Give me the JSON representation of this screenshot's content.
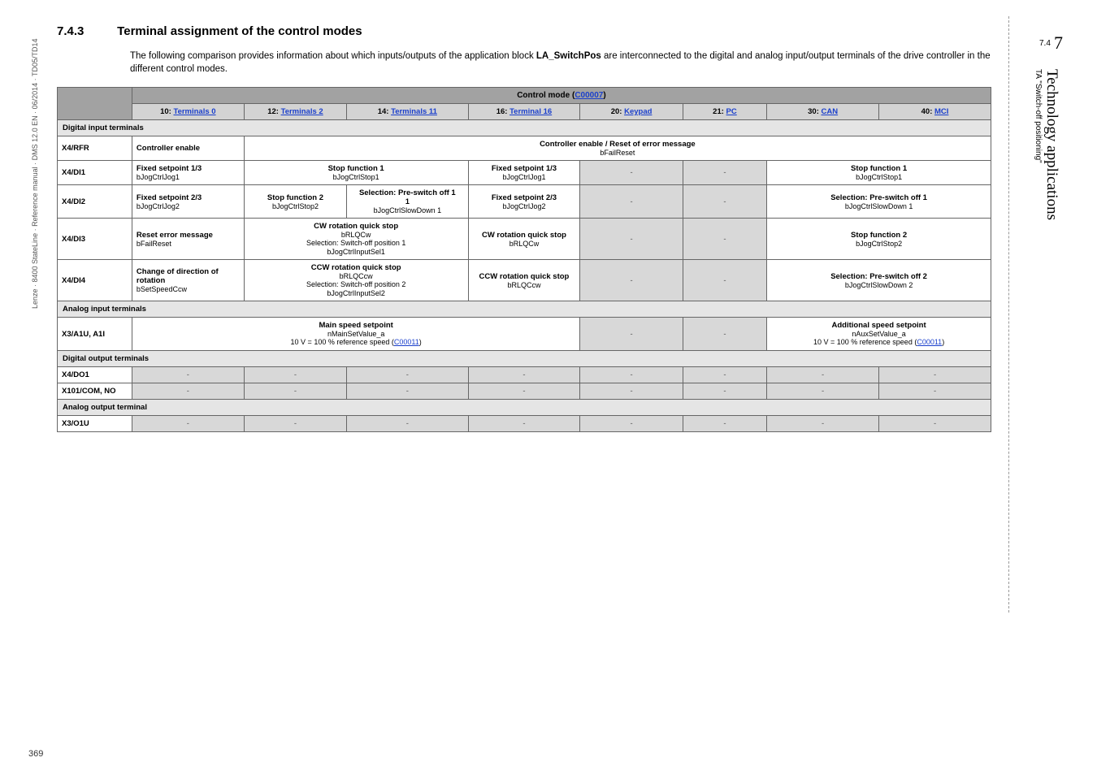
{
  "sidebar_left": "Lenze · 8400 StateLine · Reference manual · DMS 12.0 EN · 06/2014 · TD05/TD14",
  "page_number": "369",
  "sidebar_right": {
    "chap": "7",
    "sub": "7.4",
    "big": "Technology applications",
    "small": "TA \"Switch-off positioning\""
  },
  "heading": {
    "num": "7.4.3",
    "title": "Terminal assignment of the control modes"
  },
  "intro_a": "The following comparison provides information about which inputs/outputs of the application block ",
  "intro_bold": "LA_SwitchPos",
  "intro_b": " are interconnected to the digital and analog input/output terminals of the drive controller in the different control modes.",
  "table": {
    "control_mode_label": "Control mode (",
    "control_mode_code": "C00007",
    "control_mode_close": ")",
    "hdr": [
      "10: Terminals 0",
      "12: Terminals 2",
      "14: Terminals 11",
      "16: Terminal 16",
      "20: Keypad",
      "21: PC",
      "30: CAN",
      "40: MCI"
    ],
    "hdr_pre": [
      "10: ",
      "12: ",
      "14: ",
      "16: ",
      "20: ",
      "21: ",
      "30: ",
      "40: "
    ],
    "hdr_link": [
      "Terminals 0",
      "Terminals 2",
      "Terminals 11",
      "Terminal 16",
      "Keypad",
      "PC",
      "CAN",
      "MCI"
    ],
    "sec_digin": "Digital input terminals",
    "sec_anain": "Analog input terminals",
    "sec_digout": "Digital output terminals",
    "sec_anaout": "Analog output terminal",
    "rows": {
      "rfr": {
        "label": "X4/RFR",
        "c1": "Controller enable",
        "span": "Controller enable / Reset of error message",
        "span2": "bFailReset"
      },
      "di1": {
        "label": "X4/DI1",
        "c1": "Fixed setpoint 1/3",
        "c1s": "bJogCtrlJog1",
        "g1": "Stop function 1",
        "g1s": "bJogCtrlStop1",
        "c4": "Fixed setpoint 1/3",
        "c4s": "bJogCtrlJog1",
        "g2": "Stop function 1",
        "g2s": "bJogCtrlStop1"
      },
      "di2": {
        "label": "X4/DI2",
        "c1": "Fixed setpoint 2/3",
        "c1s": "bJogCtrlJog2",
        "c2": "Stop function 2",
        "c2s": "bJogCtrlStop2",
        "c3": "Selection: Pre-switch off 1",
        "c3s": "bJogCtrlSlowDown 1",
        "c4": "Fixed setpoint 2/3",
        "c4s": "bJogCtrlJog2",
        "g2": "Selection: Pre-switch off 1",
        "g2s": "bJogCtrlSlowDown 1"
      },
      "di3": {
        "label": "X4/DI3",
        "c1": "Reset error message",
        "c1s": "bFailReset",
        "g1": "CW rotation quick stop",
        "g1s": "bRLQCw",
        "g1s2": "Selection: Switch-off position 1",
        "g1s3": "bJogCtrlInputSel1",
        "c4": "CW rotation quick stop",
        "c4s": "bRLQCw",
        "g2": "Stop function 2",
        "g2s": "bJogCtrlStop2"
      },
      "di4": {
        "label": "X4/DI4",
        "c1": "Change of direction of rotation",
        "c1s": "bSetSpeedCcw",
        "g1": "CCW rotation quick stop",
        "g1s": "bRLQCcw",
        "g1s2": "Selection: Switch-off position 2",
        "g1s3": "bJogCtrlInputSel2",
        "c4": "CCW rotation quick stop",
        "c4s": "bRLQCcw",
        "g2": "Selection: Pre-switch off 2",
        "g2s": "bJogCtrlSlowDown 2"
      },
      "a1u": {
        "label": "X3/A1U, A1I",
        "g1": "Main speed setpoint",
        "g1s": "nMainSetValue_a",
        "g1s2": "10 V = 100 % reference speed (",
        "g1link": "C00011",
        "g1close": ")",
        "g2": "Additional speed setpoint",
        "g2s": "nAuxSetValue_a",
        "g2s2": "10 V = 100 % reference speed (",
        "g2link": "C00011",
        "g2close": ")"
      },
      "do1": {
        "label": "X4/DO1"
      },
      "com": {
        "label": "X101/COM, NO"
      },
      "o1u": {
        "label": "X3/O1U"
      }
    }
  }
}
